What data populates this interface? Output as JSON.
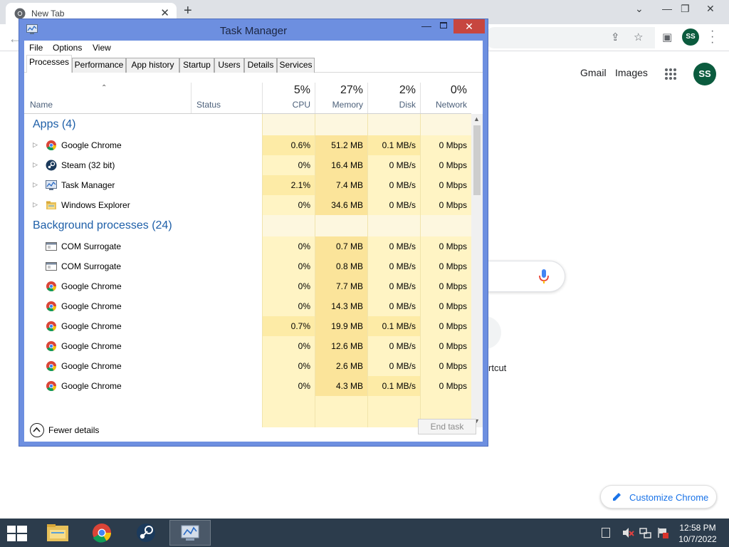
{
  "chrome": {
    "tab_title": "New Tab",
    "new_tab_symbol": "+",
    "close_symbol": "✕",
    "profile_initials": "SS",
    "header_links": {
      "gmail": "Gmail",
      "images": "Images"
    },
    "shortcut_label_partial": "rtcut",
    "customize_label": "Customize Chrome",
    "icons": [
      "chrome-logo-icon",
      "share-icon",
      "star-icon",
      "side-panel-icon",
      "apps-grid-icon",
      "mic-icon",
      "pencil-icon"
    ]
  },
  "task_manager": {
    "title": "Task Manager",
    "menu": [
      "File",
      "Options",
      "View"
    ],
    "tabs": [
      "Processes",
      "Performance",
      "App history",
      "Startup",
      "Users",
      "Details",
      "Services"
    ],
    "active_tab": "Processes",
    "columns": {
      "name": "Name",
      "status": "Status",
      "cpu": {
        "pct": "5%",
        "label": "CPU"
      },
      "memory": {
        "pct": "27%",
        "label": "Memory"
      },
      "disk": {
        "pct": "2%",
        "label": "Disk"
      },
      "network": {
        "pct": "0%",
        "label": "Network"
      }
    },
    "groups": [
      {
        "label": "Apps (4)",
        "rows": [
          {
            "name": "Google Chrome",
            "icon": "chrome",
            "cpu": "0.6%",
            "memory": "51.2 MB",
            "disk": "0.1 MB/s",
            "network": "0 Mbps",
            "expandable": true
          },
          {
            "name": "Steam (32 bit)",
            "icon": "steam",
            "cpu": "0%",
            "memory": "16.4 MB",
            "disk": "0 MB/s",
            "network": "0 Mbps",
            "expandable": true
          },
          {
            "name": "Task Manager",
            "icon": "taskmgr",
            "cpu": "2.1%",
            "memory": "7.4 MB",
            "disk": "0 MB/s",
            "network": "0 Mbps",
            "expandable": true
          },
          {
            "name": "Windows Explorer",
            "icon": "explorer",
            "cpu": "0%",
            "memory": "34.6 MB",
            "disk": "0 MB/s",
            "network": "0 Mbps",
            "expandable": true
          }
        ]
      },
      {
        "label": "Background processes (24)",
        "rows": [
          {
            "name": "COM Surrogate",
            "icon": "window",
            "cpu": "0%",
            "memory": "0.7 MB",
            "disk": "0 MB/s",
            "network": "0 Mbps",
            "expandable": false
          },
          {
            "name": "COM Surrogate",
            "icon": "window",
            "cpu": "0%",
            "memory": "0.8 MB",
            "disk": "0 MB/s",
            "network": "0 Mbps",
            "expandable": false
          },
          {
            "name": "Google Chrome",
            "icon": "chrome",
            "cpu": "0%",
            "memory": "7.7 MB",
            "disk": "0 MB/s",
            "network": "0 Mbps",
            "expandable": false
          },
          {
            "name": "Google Chrome",
            "icon": "chrome",
            "cpu": "0%",
            "memory": "14.3 MB",
            "disk": "0 MB/s",
            "network": "0 Mbps",
            "expandable": false
          },
          {
            "name": "Google Chrome",
            "icon": "chrome",
            "cpu": "0.7%",
            "memory": "19.9 MB",
            "disk": "0.1 MB/s",
            "network": "0 Mbps",
            "expandable": false
          },
          {
            "name": "Google Chrome",
            "icon": "chrome",
            "cpu": "0%",
            "memory": "12.6 MB",
            "disk": "0 MB/s",
            "network": "0 Mbps",
            "expandable": false
          },
          {
            "name": "Google Chrome",
            "icon": "chrome",
            "cpu": "0%",
            "memory": "2.6 MB",
            "disk": "0 MB/s",
            "network": "0 Mbps",
            "expandable": false
          },
          {
            "name": "Google Chrome",
            "icon": "chrome",
            "cpu": "0%",
            "memory": "4.3 MB",
            "disk": "0.1 MB/s",
            "network": "0 Mbps",
            "expandable": false
          }
        ]
      }
    ],
    "footer": {
      "fewer_details": "Fewer details",
      "end_task": "End task"
    }
  },
  "taskbar": {
    "apps": [
      "file-explorer",
      "google-chrome",
      "steam",
      "task-manager"
    ],
    "active_app": "task-manager",
    "time": "12:58 PM",
    "date": "10/7/2022"
  },
  "colors": {
    "tm_frame": "#6d8fe0",
    "tm_close": "#c7463f",
    "group_text": "#1e5fa8",
    "heat_light": "#fff4c4",
    "heat_medium": "#fdeba6",
    "taskbar": "#2c3c4c",
    "profile_green": "#0b5b3e"
  }
}
